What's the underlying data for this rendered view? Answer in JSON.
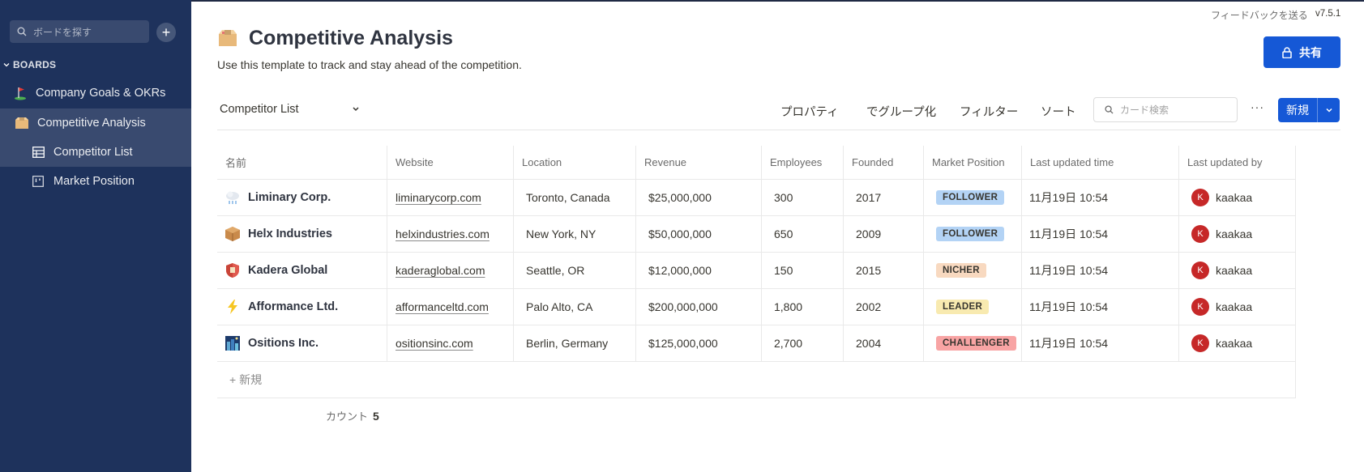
{
  "sidebar": {
    "search_placeholder": "ボードを探す",
    "boards_header": "BOARDS",
    "items": [
      {
        "label": "Company Goals & OKRs",
        "icon": "golf-flag-icon"
      },
      {
        "label": "Competitive Analysis",
        "icon": "box-icon"
      },
      {
        "label": "Competitor List",
        "icon": "table-icon"
      },
      {
        "label": "Market Position",
        "icon": "board-icon"
      }
    ]
  },
  "header": {
    "feedback": "フィードバックを送る",
    "version": "v7.5.1",
    "title": "Competitive Analysis",
    "description": "Use this template to track and stay ahead of the competition.",
    "share_label": "共有"
  },
  "toolbar": {
    "view_name": "Competitor List",
    "properties": "プロパティ",
    "group_by": "でグループ化",
    "filter": "フィルター",
    "sort": "ソート",
    "search_placeholder": "カード検索",
    "more": "···",
    "new_label": "新規"
  },
  "table": {
    "headers": [
      "名前",
      "Website",
      "Location",
      "Revenue",
      "Employees",
      "Founded",
      "Market Position",
      "Last updated time",
      "Last updated by"
    ],
    "rows": [
      {
        "name": "Liminary Corp.",
        "icon": "snow-cloud-icon",
        "website": "liminarycorp.com",
        "location": "Toronto, Canada",
        "revenue": "$25,000,000",
        "employees": "300",
        "founded": "2017",
        "position": "FOLLOWER",
        "updated": "11月19日 10:54",
        "user_initial": "K",
        "user": "kaakaa"
      },
      {
        "name": "Helx Industries",
        "icon": "package-icon",
        "website": "helxindustries.com",
        "location": "New York, NY",
        "revenue": "$50,000,000",
        "employees": "650",
        "founded": "2009",
        "position": "FOLLOWER",
        "updated": "11月19日 10:54",
        "user_initial": "K",
        "user": "kaakaa"
      },
      {
        "name": "Kadera Global",
        "icon": "shield-icon",
        "website": "kaderaglobal.com",
        "location": "Seattle, OR",
        "revenue": "$12,000,000",
        "employees": "150",
        "founded": "2015",
        "position": "NICHER",
        "updated": "11月19日 10:54",
        "user_initial": "K",
        "user": "kaakaa"
      },
      {
        "name": "Afformance Ltd.",
        "icon": "lightning-icon",
        "website": "afformanceltd.com",
        "location": "Palo Alto, CA",
        "revenue": "$200,000,000",
        "employees": "1,800",
        "founded": "2002",
        "position": "LEADER",
        "updated": "11月19日 10:54",
        "user_initial": "K",
        "user": "kaakaa"
      },
      {
        "name": "Ositions Inc.",
        "icon": "night-city-icon",
        "website": "ositionsinc.com",
        "location": "Berlin, Germany",
        "revenue": "$125,000,000",
        "employees": "2,700",
        "founded": "2004",
        "position": "CHALLENGER",
        "updated": "11月19日 10:54",
        "user_initial": "K",
        "user": "kaakaa"
      }
    ],
    "add_row": "+ 新規",
    "count_label": "カウント",
    "count_value": "5"
  },
  "colors": {
    "sidebar_bg": "#1e325c",
    "accent": "#1558d6",
    "follower": "#b3d3f5",
    "nicher": "#f8d9c0",
    "leader": "#f8eab0",
    "challenger": "#f8a4a4",
    "avatar": "#c62828"
  }
}
